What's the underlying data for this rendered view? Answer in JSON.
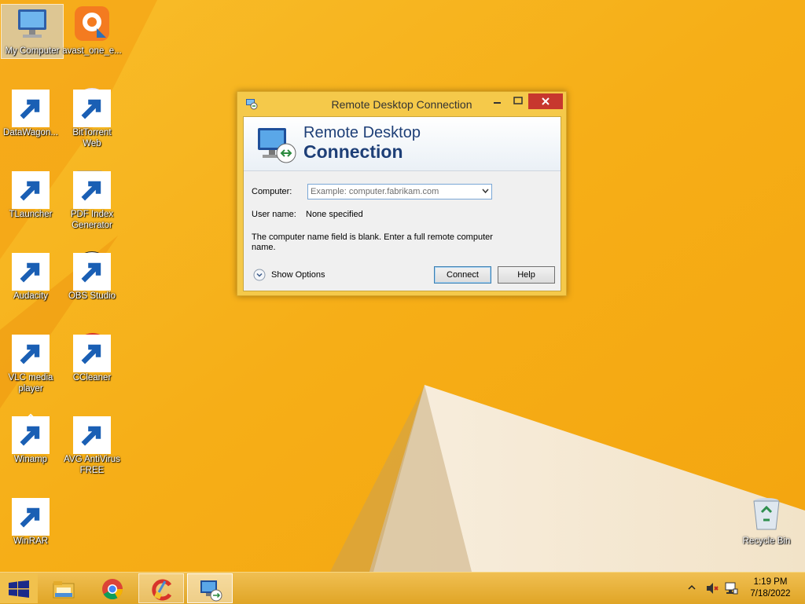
{
  "desktop": {
    "icons": [
      {
        "label": "My Computer"
      },
      {
        "label": "avast_one_e..."
      },
      {
        "label": "DataWagon..."
      },
      {
        "label": "BitTorrent\nWeb"
      },
      {
        "label": "TLauncher"
      },
      {
        "label": "PDF Index\nGenerator"
      },
      {
        "label": "Audacity"
      },
      {
        "label": "OBS Studio"
      },
      {
        "label": "VLC media\nplayer"
      },
      {
        "label": "CCleaner"
      },
      {
        "label": "Winamp"
      },
      {
        "label": "AVG AntiVirus\nFREE"
      },
      {
        "label": "WinRAR"
      },
      {
        "label": "Recycle Bin"
      }
    ]
  },
  "window": {
    "title": "Remote Desktop Connection",
    "banner_line1": "Remote Desktop",
    "banner_line2": "Connection",
    "computer_label": "Computer:",
    "computer_value": "",
    "computer_placeholder": "Example: computer.fabrikam.com",
    "username_label": "User name:",
    "username_value": "None specified",
    "blank_message": "The computer name field is blank. Enter a full remote computer name.",
    "show_options_label": "Show Options",
    "connect_label": "Connect",
    "help_label": "Help"
  },
  "taskbar": {
    "items": [
      "start-icon",
      "file-explorer-icon",
      "chrome-icon",
      "ccleaner-icon",
      "remote-desktop-icon"
    ],
    "clock_time": "1:19 PM",
    "clock_date": "7/18/2022"
  },
  "colors": {
    "wallpaper": "#f6b21a",
    "close_button": "#c7372e",
    "banner_text": "#1e3f77"
  }
}
